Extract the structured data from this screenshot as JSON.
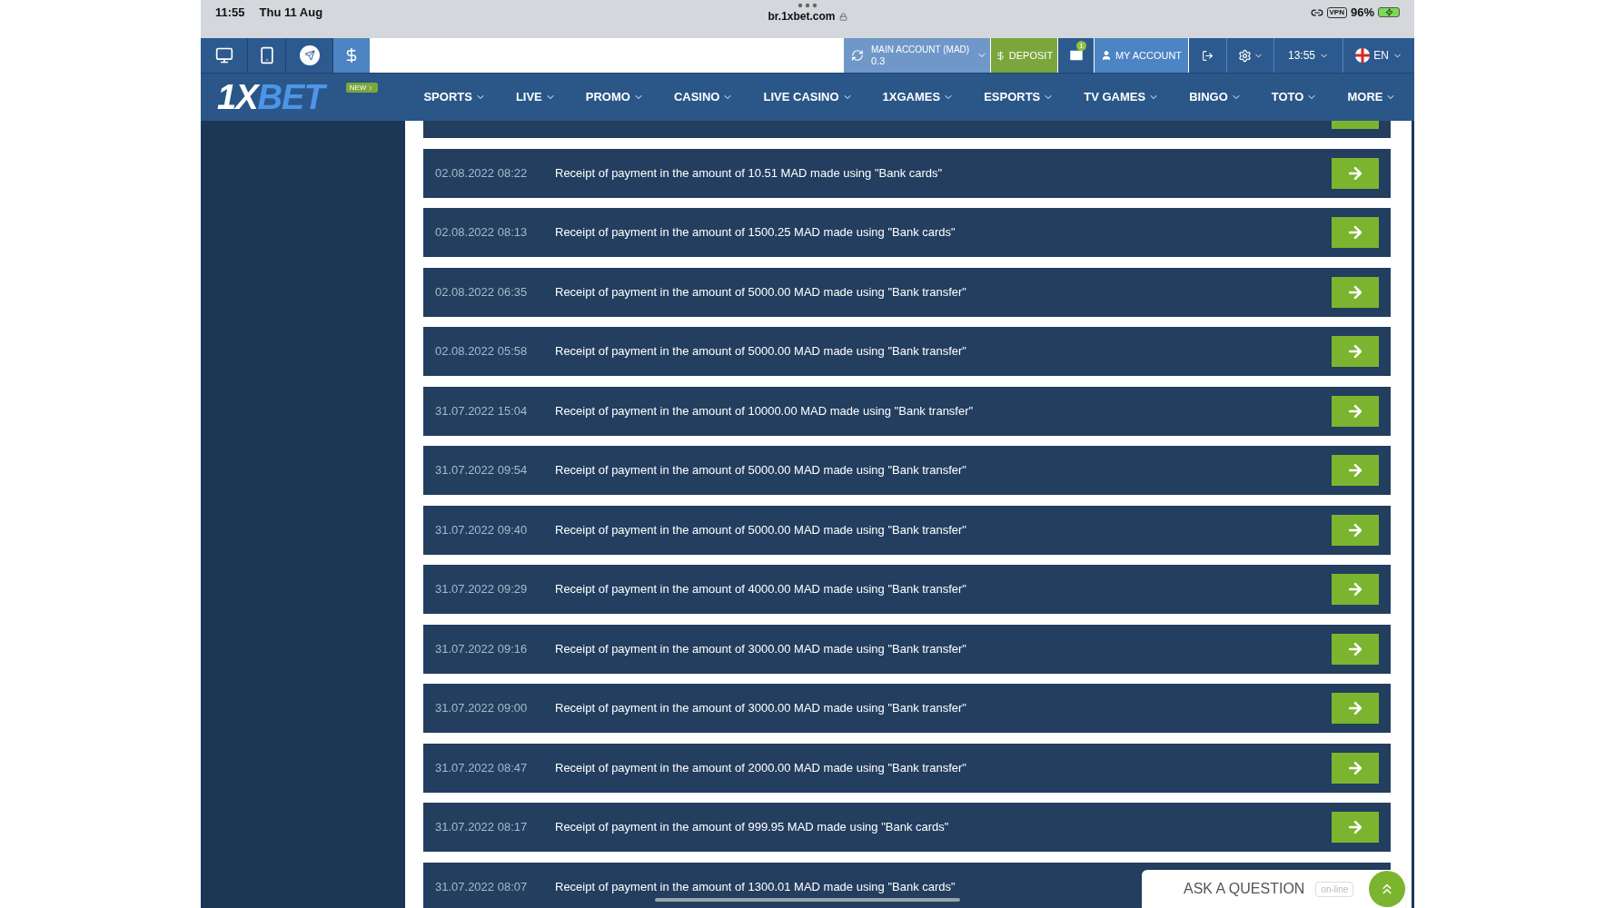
{
  "status_bar": {
    "time": "11:55",
    "date": "Thu 11 Aug",
    "url": "br.1xbet.com",
    "vpn": "VPN",
    "battery": "96%"
  },
  "top_bar": {
    "account_label": "MAIN ACCOUNT (MAD)",
    "account_balance": "0.3",
    "deposit": "DEPOSIT",
    "messages_count": "1",
    "my_account": "MY ACCOUNT",
    "time": "13:55",
    "language": "EN"
  },
  "nav": {
    "logo_first": "1X",
    "logo_second": "BET",
    "new_badge": "NEW",
    "items": [
      "SPORTS",
      "LIVE",
      "PROMO",
      "CASINO",
      "LIVE CASINO",
      "1XGAMES",
      "ESPORTS",
      "TV GAMES",
      "BINGO",
      "TOTO",
      "MORE"
    ]
  },
  "transactions": [
    {
      "date": "02.08.2022 08:22",
      "text": "Receipt of payment in the amount of 10.51 MAD made using \"Bank cards\""
    },
    {
      "date": "02.08.2022 08:13",
      "text": "Receipt of payment in the amount of 1500.25 MAD made using \"Bank cards\""
    },
    {
      "date": "02.08.2022 06:35",
      "text": "Receipt of payment in the amount of 5000.00 MAD made using \"Bank transfer\""
    },
    {
      "date": "02.08.2022 05:58",
      "text": "Receipt of payment in the amount of 5000.00 MAD made using \"Bank transfer\""
    },
    {
      "date": "31.07.2022 15:04",
      "text": "Receipt of payment in the amount of 10000.00 MAD made using \"Bank transfer\""
    },
    {
      "date": "31.07.2022 09:54",
      "text": "Receipt of payment in the amount of 5000.00 MAD made using \"Bank transfer\""
    },
    {
      "date": "31.07.2022 09:40",
      "text": "Receipt of payment in the amount of 5000.00 MAD made using \"Bank transfer\""
    },
    {
      "date": "31.07.2022 09:29",
      "text": "Receipt of payment in the amount of 4000.00 MAD made using \"Bank transfer\""
    },
    {
      "date": "31.07.2022 09:16",
      "text": "Receipt of payment in the amount of 3000.00 MAD made using \"Bank transfer\""
    },
    {
      "date": "31.07.2022 09:00",
      "text": "Receipt of payment in the amount of 3000.00 MAD made using \"Bank transfer\""
    },
    {
      "date": "31.07.2022 08:47",
      "text": "Receipt of payment in the amount of 2000.00 MAD made using \"Bank transfer\""
    },
    {
      "date": "31.07.2022 08:17",
      "text": "Receipt of payment in the amount of 999.95 MAD made using \"Bank cards\""
    },
    {
      "date": "31.07.2022 08:07",
      "text": "Receipt of payment in the amount of 1300.01 MAD made using \"Bank cards\""
    }
  ],
  "chat": {
    "label": "ASK A QUESTION",
    "status": "on-line"
  }
}
